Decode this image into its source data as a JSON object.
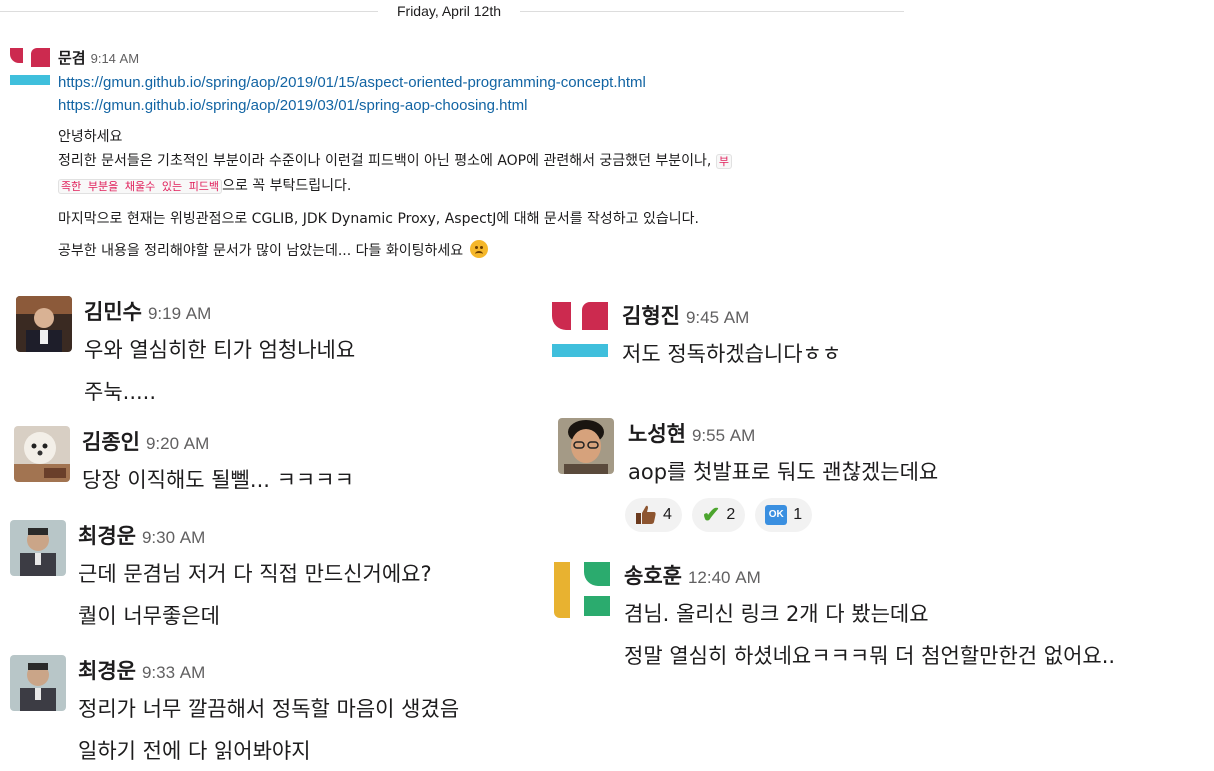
{
  "divider": {
    "date": "Friday, April 12th"
  },
  "colors": {
    "link": "#1264a3",
    "logo_red": "#cc2a4f",
    "logo_blue": "#3fbfdc",
    "logo_yellow": "#e8b230",
    "logo_green": "#2bab6e"
  },
  "messages": [
    {
      "author": "문겸",
      "time": "9:14 AM",
      "avatar": "logo-red-blue",
      "links": [
        "https://gmun.github.io/spring/aop/2019/01/15/aspect-oriented-programming-concept.html",
        "https://gmun.github.io/spring/aop/2019/03/01/spring-aop-choosing.html"
      ],
      "greeting": "안녕하세요",
      "para1_a": "정리한 문서들은 기초적인 부분이라 수준이나 이런걸 피드백이 아닌 평소에 AOP에 관련해서 궁금했던 부분이나,",
      "para1_code1": "부",
      "para1_code2": "족한 부분을 채울수 있는 피드백",
      "para1_b": "으로 꼭 부탁드립니다.",
      "para2": "마지막으로 현재는 위빙관점으로 CGLIB, JDK Dynamic Proxy, AspectJ에 대해 문서를 작성하고 있습니다.",
      "para3": "공부한 내용을 정리해야할 문서가 많이 남았는데... 다들 화이팅하세요",
      "para3_emoji": "worried-face-icon"
    },
    {
      "author": "김민수",
      "time": "9:19 AM",
      "lines": [
        "우와 열심히한 티가 엄청나네요",
        "주눅....."
      ]
    },
    {
      "author": "김종인",
      "time": "9:20 AM",
      "lines": [
        "당장 이직해도 될뻴... ㅋㅋㅋㅋ"
      ]
    },
    {
      "author": "최경운",
      "time": "9:30 AM",
      "lines": [
        "근데 문겸님 저거 다 직접 만드신거에요?",
        "퀄이 너무좋은데"
      ]
    },
    {
      "author": "최경운",
      "time": "9:33 AM",
      "lines": [
        "정리가 너무 깔끔해서 정독할 마음이 생겼음",
        "일하기 전에 다 읽어봐야지"
      ]
    },
    {
      "author": "김형진",
      "time": "9:45 AM",
      "avatar": "logo-red-blue",
      "lines": [
        "저도 정독하겠습니다ㅎㅎ"
      ]
    },
    {
      "author": "노성현",
      "time": "9:55 AM",
      "lines": [
        "aop를 첫발표로 둬도 괜찮겠는데요"
      ],
      "reactions": [
        {
          "icon": "thumbs-up-icon",
          "count": "4"
        },
        {
          "icon": "check-mark-icon",
          "count": "2"
        },
        {
          "icon": "ok-button-icon",
          "label": "OK",
          "count": "1"
        }
      ]
    },
    {
      "author": "송호훈",
      "time": "12:40 AM",
      "avatar": "logo-yellow-green",
      "lines": [
        "겸님. 올리신 링크 2개 다 봤는데요",
        "정말 열심히 하셨네요ㅋㅋㅋ뭐 더 첨언할만한건 없어요.."
      ]
    }
  ]
}
